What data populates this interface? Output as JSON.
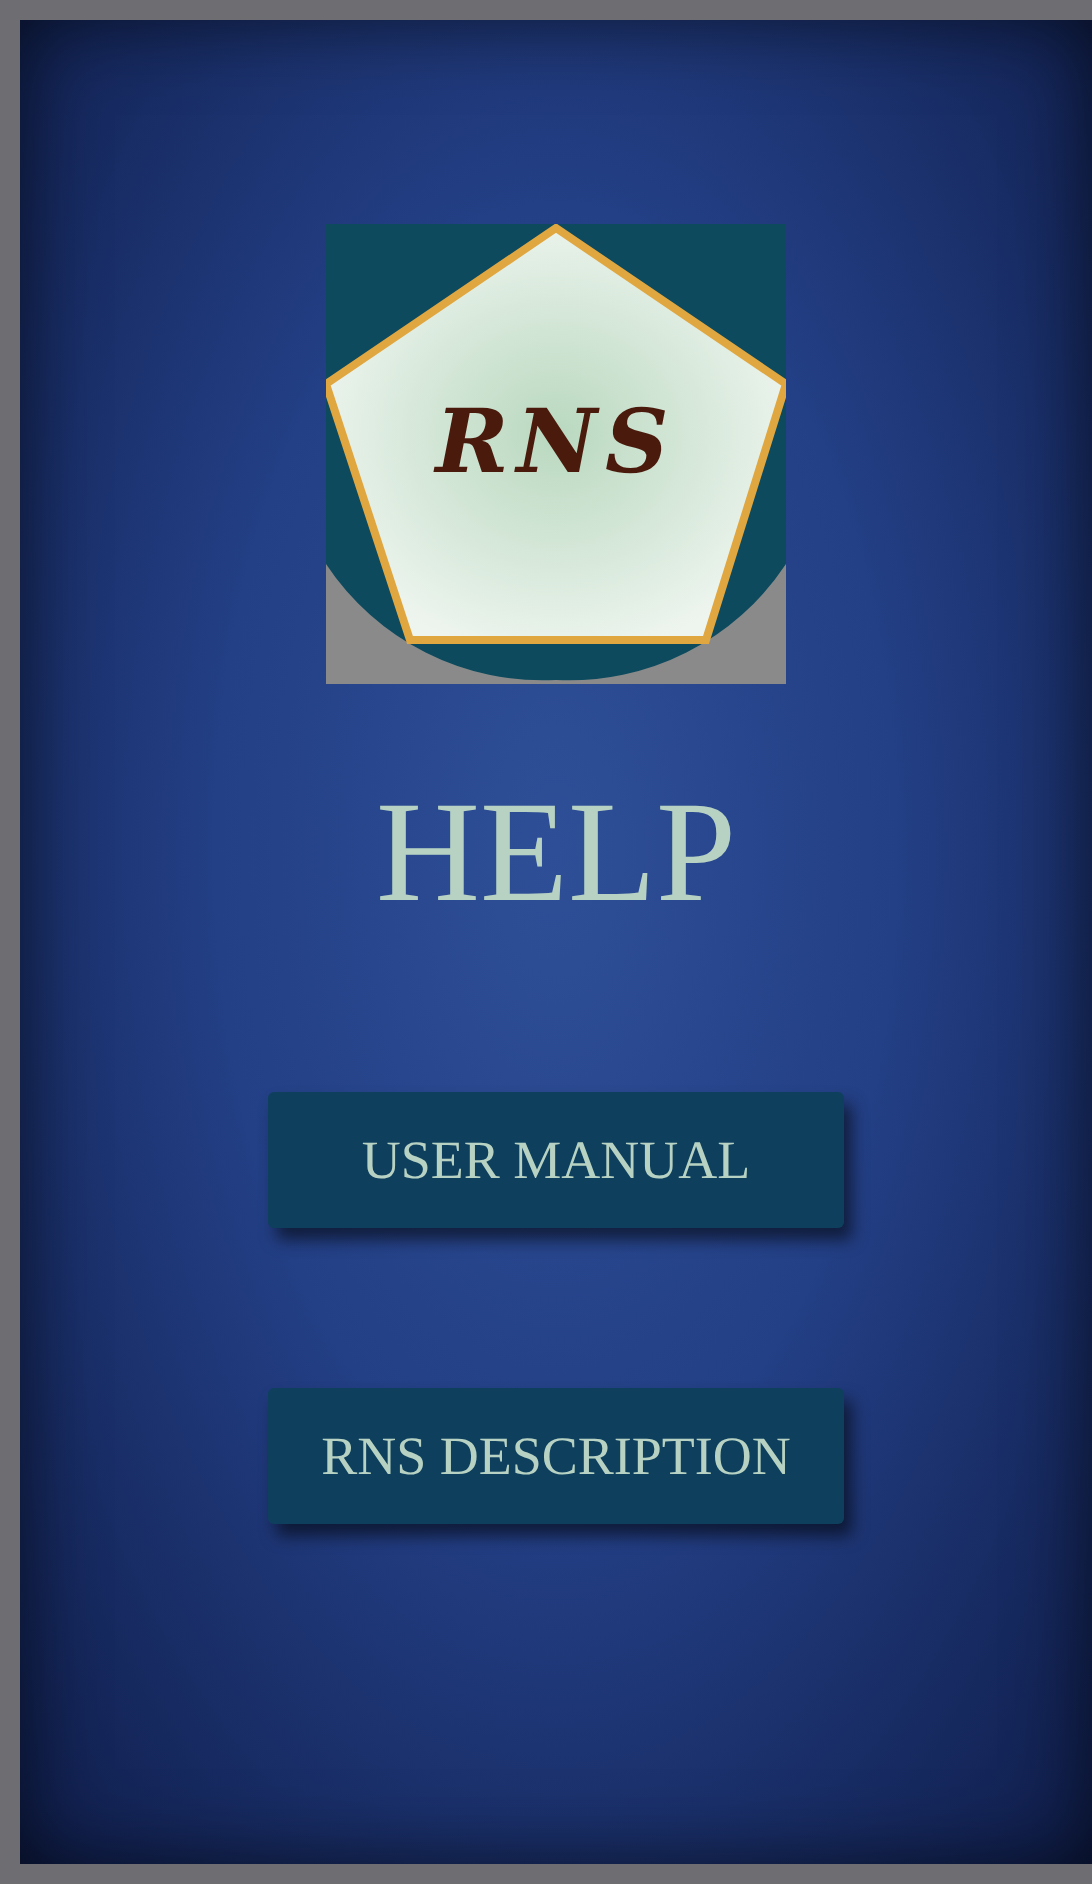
{
  "logo": {
    "text": "RNS"
  },
  "title": "HELP",
  "buttons": [
    {
      "label": "USER MANUAL"
    },
    {
      "label": "RNS DESCRIPTION"
    }
  ]
}
